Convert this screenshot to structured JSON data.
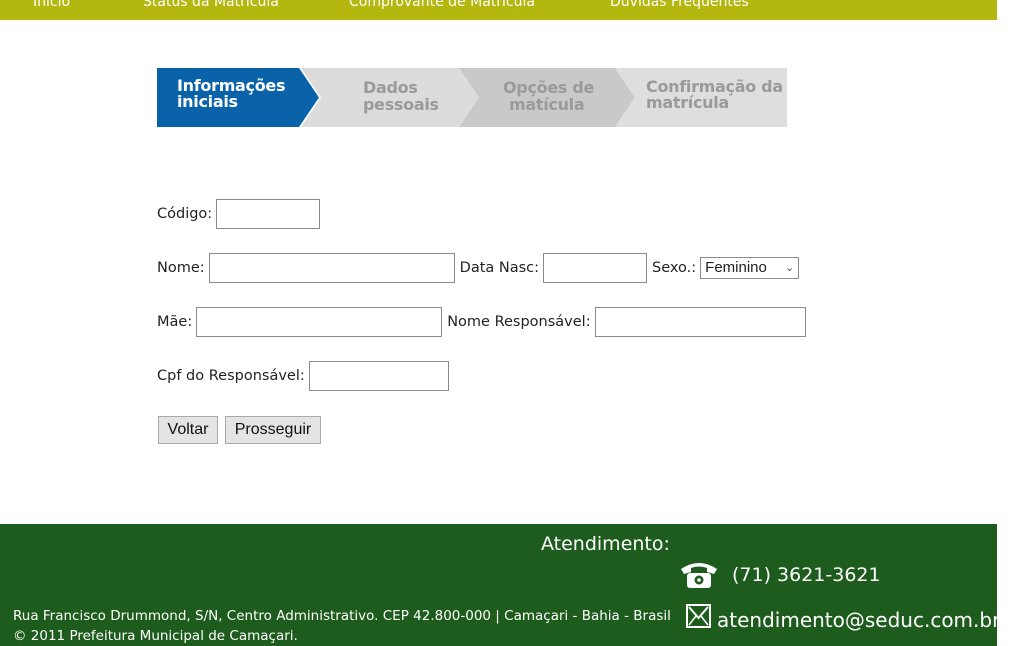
{
  "nav": {
    "items": [
      {
        "label": "Início"
      },
      {
        "label": "Status da Matrícula"
      },
      {
        "label": "Comprovante de Matrícula"
      },
      {
        "label": "Dúvidas Frequentes"
      }
    ]
  },
  "stepper": {
    "steps": [
      {
        "line1": "Informações",
        "line2": "iniciais",
        "state": "active"
      },
      {
        "line1": "Dados",
        "line2": "pessoais",
        "state": "inactive"
      },
      {
        "line1": "Opções de",
        "line2": "matícula",
        "state": "inactive"
      },
      {
        "line1": "Confirmação da",
        "line2": "matrícula",
        "state": "inactive"
      }
    ],
    "colors": {
      "active": "#0a62a9",
      "inactive1": "#dcdcdc",
      "inactive2": "#c9c9c9",
      "inactive3": "#dedede",
      "text_inactive": "#9a9a9a"
    }
  },
  "form": {
    "codigo_label": "Código:",
    "codigo_value": "",
    "nome_label": "Nome:",
    "nome_value": "",
    "data_nasc_label": "Data Nasc:",
    "data_nasc_value": "",
    "sexo_label": "Sexo.:",
    "sexo_selected": "Feminino",
    "mae_label": "Mãe:",
    "mae_value": "",
    "nome_responsavel_label": "Nome Responsável:",
    "nome_responsavel_value": "",
    "cpf_label": "Cpf do Responsável:",
    "cpf_value": ""
  },
  "buttons": {
    "voltar": "Voltar",
    "prosseguir": "Prosseguir"
  },
  "footer": {
    "atendimento_label": "Atendimento:",
    "phone": "(71) 3621-3621",
    "email": "atendimento@seduc.com.br",
    "address": "Rua Francisco Drummond, S/N, Centro Administrativo. CEP 42.800-000 | Camaçari - Bahia - Brasil",
    "copyright": "© 2011 Prefeitura Municipal de Camaçari.",
    "icons": {
      "phone": "telephone-icon",
      "email": "envelope-icon"
    },
    "colors": {
      "background": "#1d5c1c",
      "nav": "#b4b70e"
    }
  }
}
